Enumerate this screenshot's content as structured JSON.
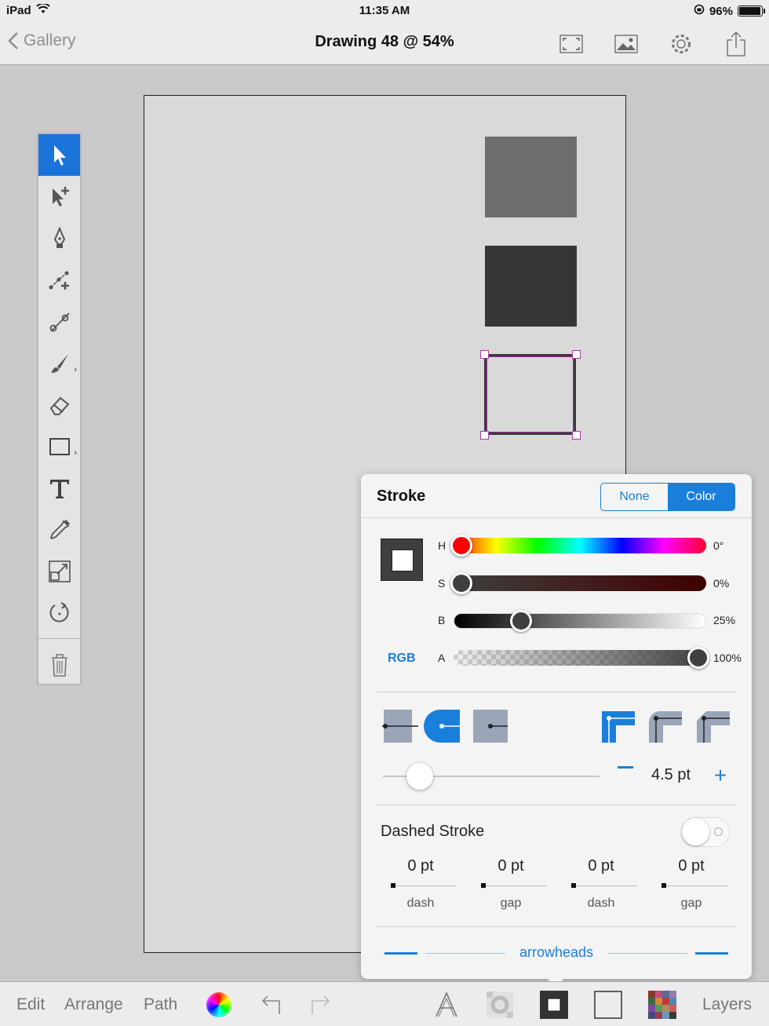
{
  "status": {
    "device": "iPad",
    "time": "11:35 AM",
    "battery": "96%",
    "battery_fraction": 0.96
  },
  "nav": {
    "back_label": "Gallery",
    "title": "Drawing 48 @ 54%",
    "icons": [
      "fit-screen-icon",
      "image-icon",
      "settings-gear-icon",
      "share-icon"
    ]
  },
  "tools": [
    "select-arrow-icon",
    "add-point-arrow-icon",
    "pen-icon",
    "node-edit-icon",
    "scissors-icon",
    "brush-icon",
    "eraser-icon",
    "rectangle-icon",
    "text-icon",
    "eyedropper-icon",
    "transform-icon",
    "rotate-icon",
    "trash-icon"
  ],
  "panel": {
    "title": "Stroke",
    "seg_none": "None",
    "seg_color": "Color",
    "selected_mode": "Color",
    "sliders": [
      {
        "label": "H",
        "value_text": "0°",
        "fraction": 0.0
      },
      {
        "label": "S",
        "value_text": "0%",
        "fraction": 0.0
      },
      {
        "label": "B",
        "value_text": "25%",
        "fraction": 0.25
      },
      {
        "label": "A",
        "value_text": "100%",
        "fraction": 1.0
      }
    ],
    "color_model": "RGB",
    "caps": [
      "butt-cap-icon",
      "round-cap-icon",
      "square-cap-icon"
    ],
    "joins": [
      "miter-join-icon",
      "round-join-icon",
      "bevel-join-icon"
    ],
    "width_value": "4.5 pt",
    "width_fraction": 0.17,
    "dashed_title": "Dashed Stroke",
    "dashed_enabled": false,
    "dash_fields": [
      {
        "value": "0 pt",
        "label": "dash"
      },
      {
        "value": "0 pt",
        "label": "gap"
      },
      {
        "value": "0 pt",
        "label": "dash"
      },
      {
        "value": "0 pt",
        "label": "gap"
      }
    ],
    "arrowheads_label": "arrowheads"
  },
  "bottom": {
    "edit": "Edit",
    "arrange": "Arrange",
    "path": "Path",
    "layers": "Layers"
  },
  "colors": {
    "accent": "#1a7fdb",
    "selection": "#a838a8",
    "fill_light": "#6d6d6f",
    "fill_dark": "#363638"
  }
}
